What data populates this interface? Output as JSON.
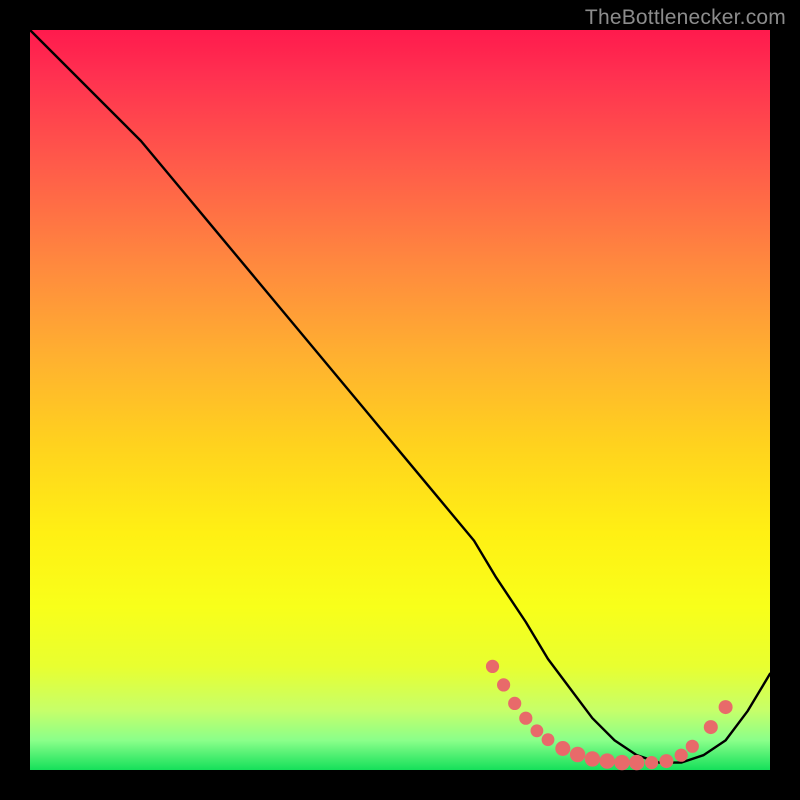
{
  "watermark_text": "TheBottlenecker.com",
  "chart_data": {
    "type": "line",
    "title": "",
    "xlabel": "",
    "ylabel": "",
    "xlim": [
      0,
      100
    ],
    "ylim": [
      0,
      100
    ],
    "series": [
      {
        "name": "curve",
        "x": [
          0,
          6,
          10,
          15,
          20,
          25,
          30,
          35,
          40,
          45,
          50,
          55,
          60,
          63,
          67,
          70,
          73,
          76,
          79,
          82,
          85,
          88,
          91,
          94,
          97,
          100
        ],
        "y": [
          100,
          94,
          90,
          85,
          79,
          73,
          67,
          61,
          55,
          49,
          43,
          37,
          31,
          26,
          20,
          15,
          11,
          7,
          4,
          2,
          1,
          1,
          2,
          4,
          8,
          13
        ]
      }
    ],
    "markers": {
      "name": "bottom-dots",
      "color": "#e86a6a",
      "points": [
        {
          "x": 62.5,
          "y": 14.0,
          "r": 3.0
        },
        {
          "x": 64.0,
          "y": 11.5,
          "r": 3.0
        },
        {
          "x": 65.5,
          "y": 9.0,
          "r": 3.0
        },
        {
          "x": 67.0,
          "y": 7.0,
          "r": 3.0
        },
        {
          "x": 68.5,
          "y": 5.3,
          "r": 2.9
        },
        {
          "x": 70.0,
          "y": 4.1,
          "r": 2.9
        },
        {
          "x": 72.0,
          "y": 2.9,
          "r": 3.4
        },
        {
          "x": 74.0,
          "y": 2.1,
          "r": 3.5
        },
        {
          "x": 76.0,
          "y": 1.5,
          "r": 3.5
        },
        {
          "x": 78.0,
          "y": 1.2,
          "r": 3.5
        },
        {
          "x": 80.0,
          "y": 1.0,
          "r": 3.5
        },
        {
          "x": 82.0,
          "y": 1.0,
          "r": 3.5
        },
        {
          "x": 84.0,
          "y": 1.0,
          "r": 3.0
        },
        {
          "x": 86.0,
          "y": 1.2,
          "r": 3.2
        },
        {
          "x": 88.0,
          "y": 2.0,
          "r": 3.0
        },
        {
          "x": 89.5,
          "y": 3.2,
          "r": 3.0
        },
        {
          "x": 92.0,
          "y": 5.8,
          "r": 3.2
        },
        {
          "x": 94.0,
          "y": 8.5,
          "r": 3.2
        }
      ]
    }
  }
}
